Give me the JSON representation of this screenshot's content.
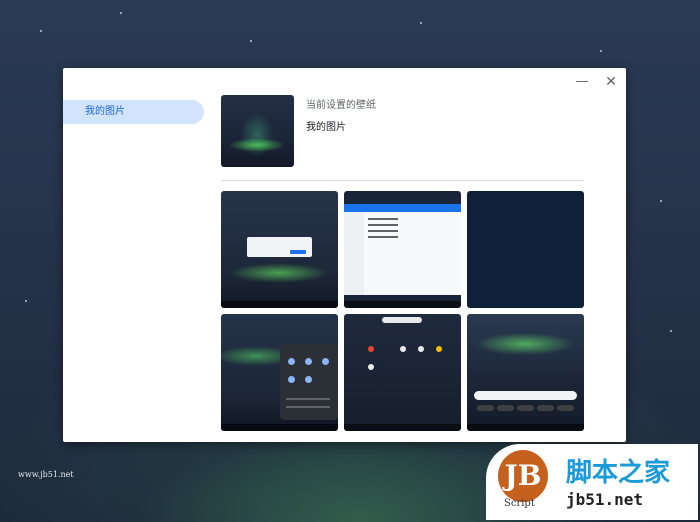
{
  "window": {
    "minimize_icon": "minimize-icon",
    "close_icon": "close-icon"
  },
  "sidebar": {
    "items": [
      {
        "label": "我的图片",
        "selected": true
      }
    ]
  },
  "current": {
    "label": "当前设置的壁纸",
    "name": "我的图片"
  },
  "thumbnails": [
    {
      "name": "wallpaper-aurora-dialog"
    },
    {
      "name": "wallpaper-files-app"
    },
    {
      "name": "wallpaper-dark-blue"
    },
    {
      "name": "wallpaper-quick-settings"
    },
    {
      "name": "wallpaper-launcher"
    },
    {
      "name": "wallpaper-aurora-search"
    }
  ],
  "watermark": {
    "url_left": "www.jb51.net",
    "logo_badge": "JB",
    "logo_sub": "Script",
    "logo_title": "脚本之家",
    "logo_url": "jb51.net"
  },
  "colors": {
    "accent": "#1967d2",
    "selected_bg": "#d2e3fc"
  }
}
